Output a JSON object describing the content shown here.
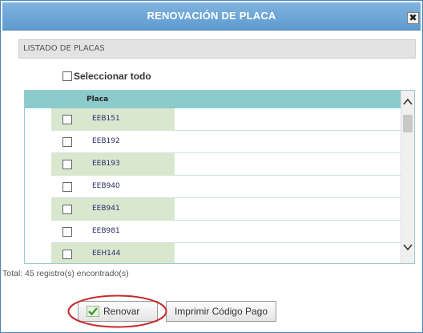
{
  "dialog": {
    "title": "RENOVACIÓN DE PLACA",
    "close_glyph": "✖"
  },
  "section": {
    "title": "LISTADO DE PLACAS"
  },
  "select_all": {
    "label": "Seleccionar todo",
    "checked": false
  },
  "table": {
    "columns": [
      "Placa"
    ],
    "rows": [
      {
        "placa": "EEB151",
        "checked": false
      },
      {
        "placa": "EEB192",
        "checked": false
      },
      {
        "placa": "EEB193",
        "checked": false
      },
      {
        "placa": "EEB940",
        "checked": false
      },
      {
        "placa": "EEB941",
        "checked": false
      },
      {
        "placa": "EEB981",
        "checked": false
      },
      {
        "placa": "EEH144",
        "checked": false
      }
    ]
  },
  "footer": {
    "total_text": "Total: 45 registro(s) encontrado(s)"
  },
  "buttons": {
    "renovar_label": "Renovar",
    "imprimir_label": "Imprimir Código Pago"
  },
  "icons": {
    "close": "close-icon",
    "check": "check-icon",
    "scroll_up": "chevron-up-icon",
    "scroll_down": "chevron-down-icon"
  },
  "colors": {
    "titlebar": "#6ba6d8",
    "header_row": "#8ccbcb",
    "alt_row": "#d9e7cf",
    "highlight": "#c62828",
    "check_green": "#3c9a2f"
  }
}
